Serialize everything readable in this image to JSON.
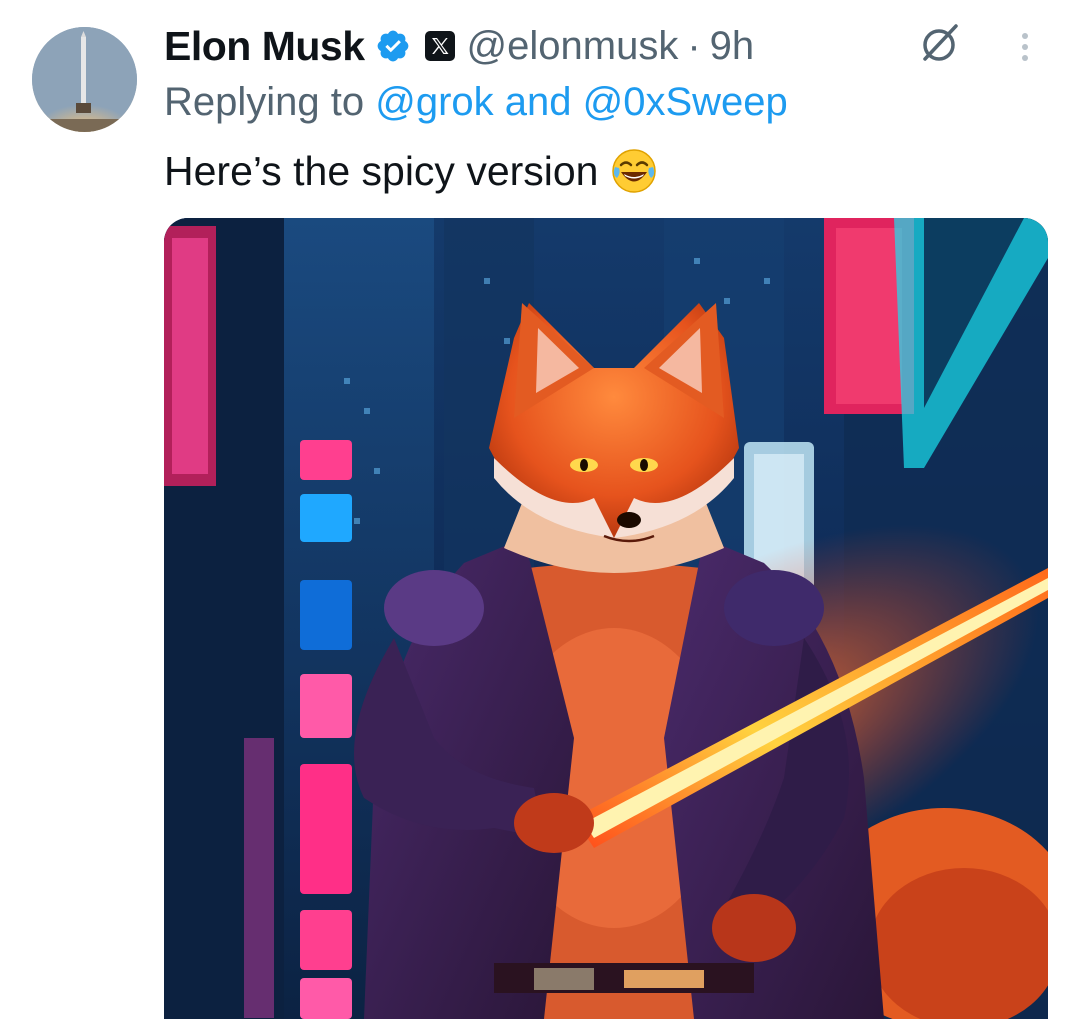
{
  "tweet": {
    "author_name": "Elon Musk",
    "author_handle": "@elonmusk",
    "separator": "·",
    "time": "9h",
    "reply_prefix": "Replying to ",
    "reply_user_1": "@grok",
    "reply_joiner": " and ",
    "reply_user_2": "@0xSweep",
    "text": "Here’s the spicy version",
    "emoji": "face-with-tears-of-joy"
  },
  "icons": {
    "verified": "verified-badge-icon",
    "x_logo": "x-logo-icon",
    "grok": "grok-icon",
    "more": "more-vertical-icon"
  },
  "colors": {
    "text_primary": "#0f1419",
    "text_secondary": "#536471",
    "link": "#1d9bf0",
    "verified": "#1d9bf0"
  }
}
